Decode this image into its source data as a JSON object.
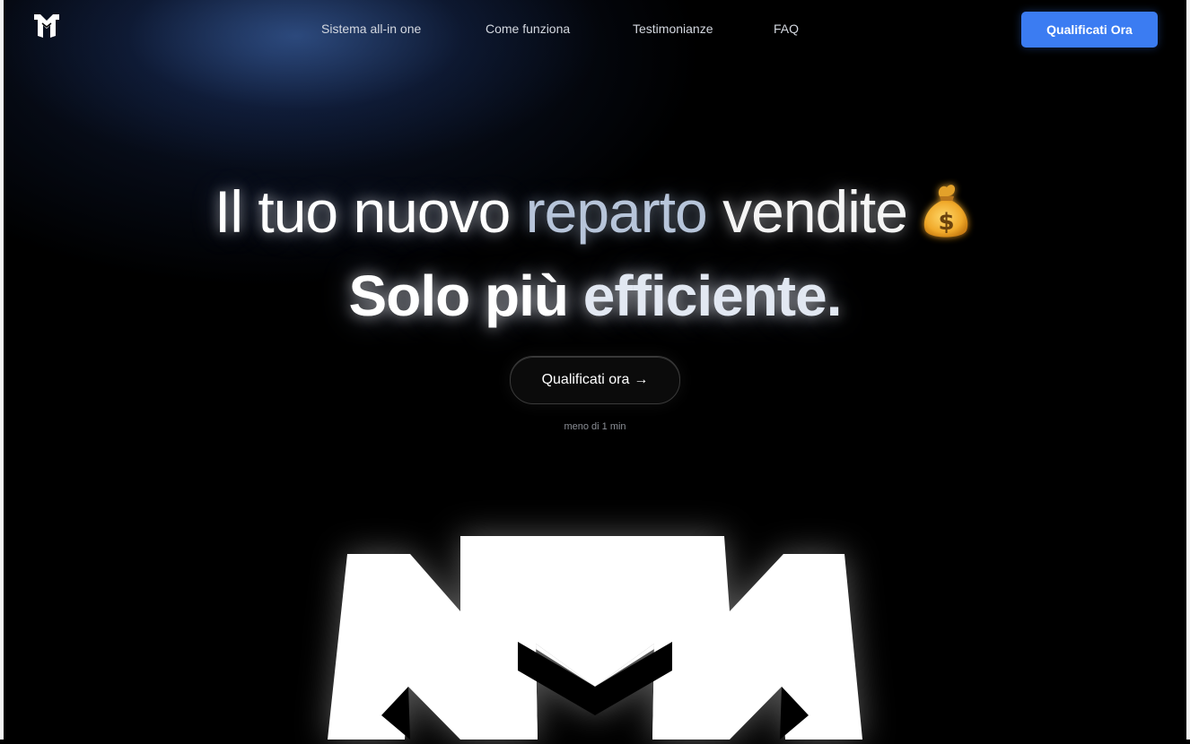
{
  "brand": {
    "logo_icon": "mm-monogram-logo"
  },
  "nav": {
    "links": [
      {
        "label": "Sistema all-in one"
      },
      {
        "label": "Come funziona"
      },
      {
        "label": "Testimonianze"
      },
      {
        "label": "FAQ"
      }
    ],
    "cta_label": "Qualificati Ora"
  },
  "hero": {
    "line1_part1": "Il tuo nuovo",
    "line1_part2": "reparto",
    "line1_part3": "vendite",
    "emoji_icon": "money-bag-icon",
    "line2_part1": "Solo più",
    "line2_part2": "efficiente.",
    "cta_label": "Qualificati ora",
    "cta_arrow": "→",
    "sub_note": "meno di 1 min"
  },
  "colors": {
    "accent": "#3b7cf2",
    "background": "#000000",
    "glow": "#4673be"
  }
}
